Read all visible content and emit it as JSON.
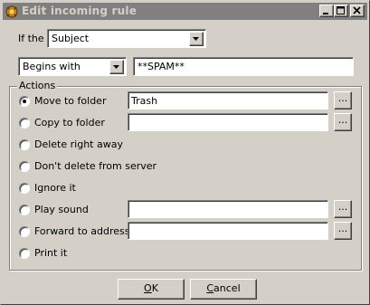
{
  "window": {
    "title": "Edit incoming rule"
  },
  "condition": {
    "if_label": "If the",
    "field_value": "Subject",
    "operator_value": "Begins with",
    "match_text": "**SPAM**"
  },
  "actions": {
    "group_label": "Actions",
    "selected": "move",
    "items": [
      {
        "key": "move",
        "label": "Move to folder",
        "value": "Trash",
        "has_field": true,
        "has_browse": true
      },
      {
        "key": "copy",
        "label": "Copy to folder",
        "value": "",
        "has_field": true,
        "has_browse": true
      },
      {
        "key": "delete",
        "label": "Delete right away",
        "has_field": false,
        "has_browse": false
      },
      {
        "key": "keep",
        "label": "Don't delete from server",
        "has_field": false,
        "has_browse": false
      },
      {
        "key": "ignore",
        "label": "Ignore it",
        "has_field": false,
        "has_browse": false
      },
      {
        "key": "sound",
        "label": "Play sound",
        "value": "",
        "has_field": true,
        "has_browse": true
      },
      {
        "key": "forward",
        "label": "Forward to address",
        "value": "",
        "has_field": true,
        "has_browse": true
      },
      {
        "key": "print",
        "label": "Print it",
        "has_field": false,
        "has_browse": false
      }
    ],
    "browse_label": "..."
  },
  "buttons": {
    "ok_mnemonic": "O",
    "ok_rest": "K",
    "cancel_mnemonic": "C",
    "cancel_rest": "ancel"
  },
  "icons": {
    "app": "app-icon",
    "minimize": "minimize-icon",
    "maximize": "maximize-icon",
    "close": "close-icon",
    "dropdown": "chevron-down-icon"
  },
  "colors": {
    "face": "#d4d0c8",
    "titlebar_inactive": "#808080",
    "title_text": "#d4d0c8"
  }
}
